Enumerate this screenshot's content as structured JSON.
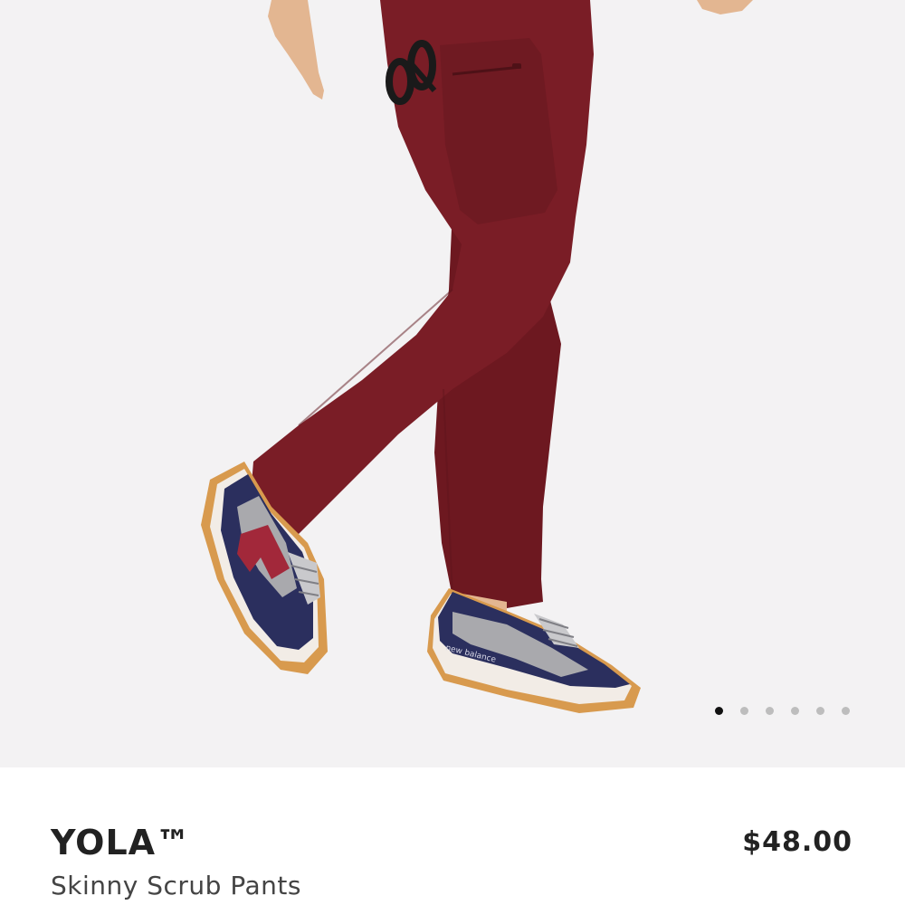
{
  "product": {
    "name": "YOLA™",
    "subtitle": "Skinny Scrub Pants",
    "price": "$48.00"
  },
  "gallery": {
    "image_alt": "Model wearing burgundy skinny scrub pants with navy and grey sneakers",
    "total_images": 6,
    "active_index": 1,
    "dots": [
      "1",
      "2",
      "3",
      "4",
      "5",
      "6"
    ],
    "shoe_brand_text": "new balance"
  },
  "colors": {
    "pants": "#7a1d26",
    "background": "#f3f2f3",
    "sneaker_navy": "#2b2f5e",
    "sneaker_grey": "#a9a9ad",
    "sneaker_accent": "#a2283a",
    "sole_gum": "#d89a4e"
  }
}
